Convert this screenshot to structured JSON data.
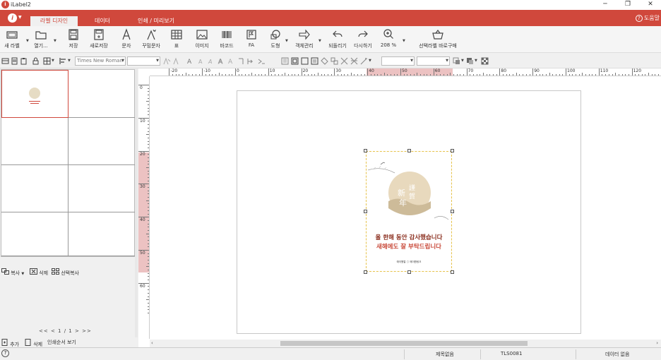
{
  "app": {
    "title": "iLabel2",
    "logo_glyph": "i",
    "accent": "#d0483c"
  },
  "window_controls": {
    "minimize": "─",
    "restore": "❐",
    "close": "✕"
  },
  "tabs": [
    {
      "label": "라벨 디자인",
      "active": true
    },
    {
      "label": "데이터",
      "active": false
    },
    {
      "label": "인쇄 / 미리보기",
      "active": false
    }
  ],
  "help": {
    "label": "도움말",
    "icon": "question-circle-icon"
  },
  "toolbar": {
    "new_label": "새 라벨",
    "open": "열기...",
    "save": "저장",
    "save_as": "새로저장",
    "text": "문자",
    "curved_text": "꾸밈문자",
    "table": "표",
    "image": "이미지",
    "barcode": "바코드",
    "fa": "FA",
    "shape": "도형",
    "object_manage": "객체관리",
    "undo": "되돌리기",
    "redo": "다시하기",
    "zoom": "208 %",
    "buy": "선택라벨 바로구매"
  },
  "format_bar": {
    "font_name": "Times New Roman",
    "font_size": "",
    "box3": "",
    "box4": ""
  },
  "left_panel": {
    "copy": "복사",
    "delete": "삭제",
    "select_copy": "선택복사",
    "pager": "<<   <     1 / 1     >   >>",
    "add": "추가",
    "remove": "삭제",
    "print_order": "인쇄순서 보기"
  },
  "ruler": {
    "h_labels": [
      "-20",
      "-10",
      "0",
      "10",
      "20",
      "30",
      "40",
      "50",
      "60",
      "70",
      "80",
      "90",
      "100",
      "110",
      "120"
    ],
    "v_labels": [
      "0",
      "10",
      "20",
      "30",
      "40",
      "50",
      "60"
    ]
  },
  "label_content": {
    "greeting_line1": "올 한해 동안 감사했습니다",
    "greeting_line2": "새해에도 잘 부탁드립니다",
    "seal_chars": "新年謹賀",
    "footer": "에이원얼 ⓘ 에이원링크"
  },
  "status": {
    "title": "제목없음",
    "code": "TLS0081",
    "data": "데이터 없음"
  }
}
